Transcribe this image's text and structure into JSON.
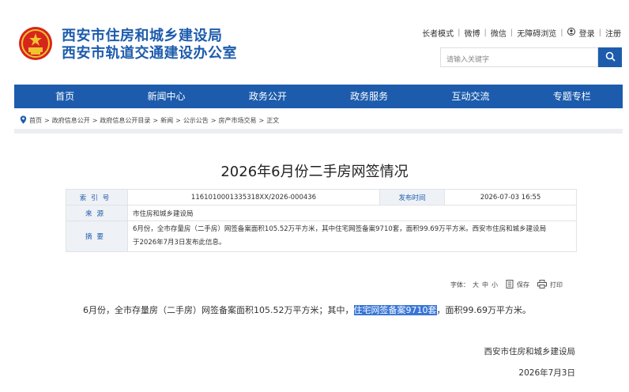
{
  "header": {
    "org_line1": "西安市住房和城乡建设局",
    "org_line2": "西安市轨道交通建设办公室",
    "top_links": [
      "长者模式",
      "微博",
      "微信",
      "无障碍浏览"
    ],
    "login": "登录",
    "register": "注册",
    "search_placeholder": "请输入关键字"
  },
  "nav": [
    "首页",
    "新闻中心",
    "政务公开",
    "政务服务",
    "互动交流",
    "专题专栏"
  ],
  "breadcrumb": [
    "首页",
    "政府信息公开",
    "政府信息公开目录",
    "新闻",
    "公示公告",
    "房产市场交易",
    "正文"
  ],
  "article": {
    "title": "2026年6月份二手房网签情况",
    "meta": {
      "index_label": "索引号",
      "index_value": "116101000133531​8XX/2026-000436",
      "publish_label": "发布时间",
      "publish_value": "2026-07-03 16:55",
      "source_label": "来源",
      "source_value": "市住房和城乡建设局",
      "abstract_label": "摘要",
      "abstract_line1": "6月份，全市存量房（二手房）网签备案面积105.52万平方米，其中住宅网签备案9710套，面积99.69万平方米。西安市住房和城乡建设局",
      "abstract_line2": "于2026年7月3日发布此信息。"
    },
    "tools": {
      "font_label": "字体：",
      "font_large": "大",
      "font_medium": "中",
      "font_small": "小",
      "save": "保存",
      "print": "打印"
    },
    "body_before": "6月份，全市存量房（二手房）网签备案面积105.52万平方米；其中，",
    "body_highlight": "住宅网签备案9710套",
    "body_after": "，面积99.69万平方米。",
    "signature": "西安市住房和城乡建设局",
    "date": "2026年7月3日"
  },
  "colors": {
    "brand_blue": "#1d5cad",
    "selection": "#3875d7",
    "label_bg": "#eef1f5"
  }
}
